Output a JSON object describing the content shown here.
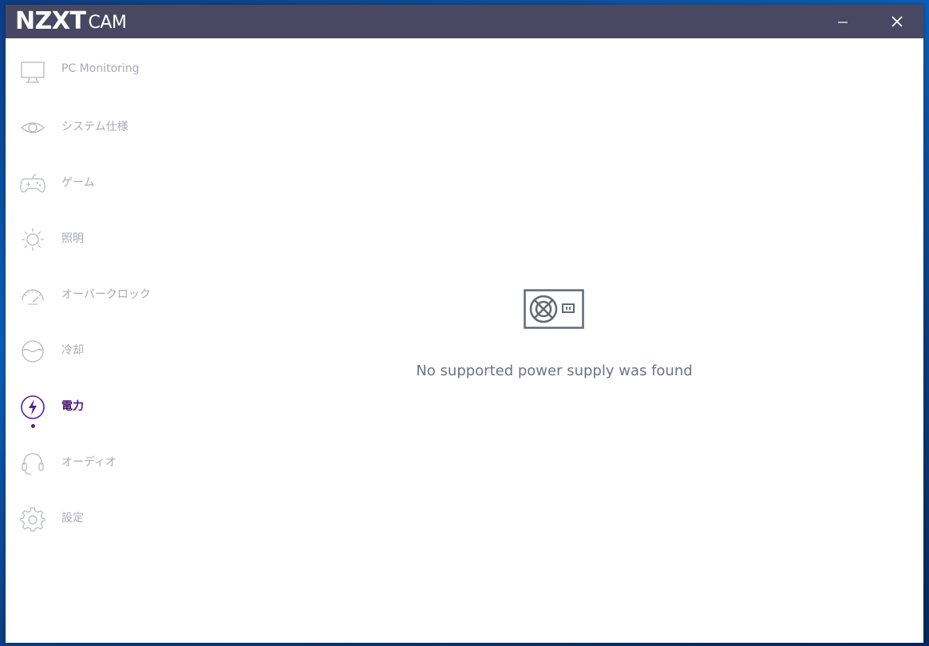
{
  "titlebar": {
    "brand_main": "NZXT",
    "brand_sub": "CAM",
    "minimize_glyph": "—",
    "close_glyph": "✕"
  },
  "sidebar": {
    "items": [
      {
        "label": "PC Monitoring",
        "icon": "monitor-icon"
      },
      {
        "label": "システム仕様",
        "icon": "eye-icon"
      },
      {
        "label": "ゲーム",
        "icon": "gamepad-icon"
      },
      {
        "label": "照明",
        "icon": "sun-icon"
      },
      {
        "label": "オーバークロック",
        "icon": "gauge-icon"
      },
      {
        "label": "冷却",
        "icon": "water-icon"
      },
      {
        "label": "電力",
        "icon": "lightning-icon",
        "active": true
      },
      {
        "label": "オーディオ",
        "icon": "headset-icon"
      },
      {
        "label": "設定",
        "icon": "gear-icon"
      }
    ]
  },
  "main": {
    "empty_icon": "power-supply-icon",
    "message": "No supported power supply was found"
  },
  "colors": {
    "titlebar": "#484863",
    "active": "#5b1f8a",
    "inactive_text": "#a9aab6",
    "icon_gray": "#5e6a75"
  }
}
